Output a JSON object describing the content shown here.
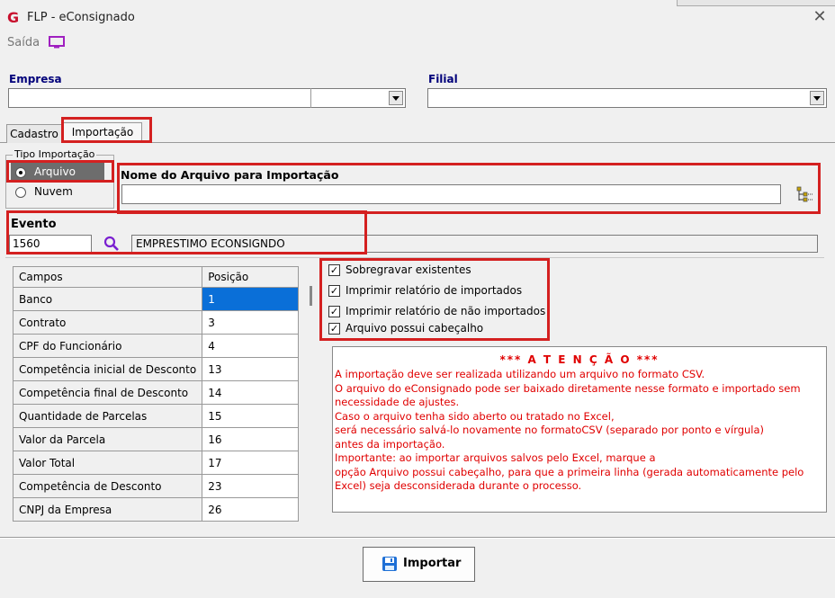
{
  "window": {
    "title": "FLP - eConsignado"
  },
  "menu": {
    "exit_label": "Saída"
  },
  "empresa": {
    "label": "Empresa",
    "value": ""
  },
  "filial": {
    "label": "Filial",
    "value": ""
  },
  "tabs": [
    {
      "label": "Cadastro"
    },
    {
      "label": "Importação"
    }
  ],
  "import_type": {
    "legend": "Tipo Importação",
    "options": [
      {
        "label": "Arquivo",
        "selected": true
      },
      {
        "label": "Nuvem",
        "selected": false
      }
    ]
  },
  "file": {
    "label": "Nome do Arquivo para Importação",
    "value": ""
  },
  "evento": {
    "label": "Evento",
    "code": "1560",
    "description": "EMPRESTIMO ECONSIGNDO"
  },
  "fields_table": {
    "headers": [
      "Campos",
      "Posição"
    ],
    "rows": [
      {
        "campo": "Banco",
        "posicao": "1"
      },
      {
        "campo": "Contrato",
        "posicao": "3"
      },
      {
        "campo": "CPF do Funcionário",
        "posicao": "4"
      },
      {
        "campo": "Competência inicial de Desconto",
        "posicao": "13"
      },
      {
        "campo": "Competência final de Desconto",
        "posicao": "14"
      },
      {
        "campo": "Quantidade de Parcelas",
        "posicao": "15"
      },
      {
        "campo": "Valor da Parcela",
        "posicao": "16"
      },
      {
        "campo": "Valor Total",
        "posicao": "17"
      },
      {
        "campo": "Competência de Desconto",
        "posicao": "23"
      },
      {
        "campo": "CNPJ da Empresa",
        "posicao": "26"
      }
    ]
  },
  "options": [
    {
      "label": "Sobregravar existentes",
      "checked": true
    },
    {
      "label": "Imprimir relatório de importados",
      "checked": true
    },
    {
      "label": "Imprimir relatório de não importados",
      "checked": true
    },
    {
      "label": "Arquivo possui cabeçalho",
      "checked": true
    }
  ],
  "attention": {
    "title": "*** A T E N Ç Ã O ***",
    "lines": [
      "A importação deve ser realizada utilizando um arquivo no formato CSV.",
      "O arquivo do eConsignado pode ser baixado diretamente nesse formato e importado sem",
      "necessidade de ajustes.",
      "Caso o arquivo tenha sido aberto ou tratado no Excel,",
      "será necessário salvá-lo novamente no formatoCSV (separado por ponto e vírgula)",
      "antes da importação.",
      "Importante: ao importar arquivos salvos pelo Excel, marque a",
      "opção Arquivo possui cabeçalho, para que a primeira linha (gerada automaticamente pelo",
      "Excel) seja desconsiderada durante o processo."
    ]
  },
  "import_button": {
    "label": "Importar"
  },
  "colors": {
    "highlight": "#d42020",
    "attention_text": "#e00000",
    "label_blue": "#00007a",
    "selection": "#0a6fd8"
  },
  "icons": [
    "app-logo-icon",
    "close-icon",
    "monitor-icon",
    "folder-tree-icon",
    "search-icon",
    "save-icon"
  ]
}
